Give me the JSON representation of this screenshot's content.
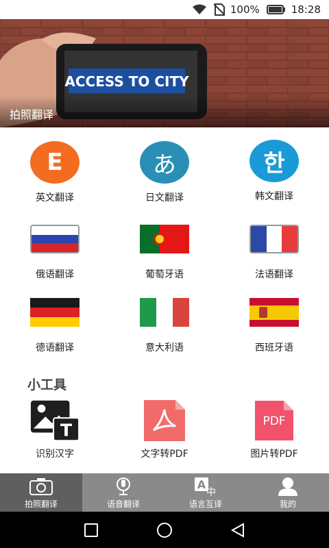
{
  "status_bar": {
    "battery_percent": "100%",
    "time": "18:28"
  },
  "banner": {
    "caption": "拍照翻译",
    "sign_text": "ACCESS TO CITY"
  },
  "languages": [
    {
      "label": "英文翻译",
      "icon": "letter-e-icon",
      "glyph": "E",
      "color": "#f36c21"
    },
    {
      "label": "日文翻译",
      "icon": "hiragana-a-icon",
      "glyph": "あ",
      "color": "#2a8fb5"
    },
    {
      "label": "韩文翻译",
      "icon": "hangul-han-icon",
      "glyph": "한",
      "color": "#1a9ad6"
    },
    {
      "label": "俄语翻译",
      "icon": "russia-flag-icon"
    },
    {
      "label": "葡萄牙语",
      "icon": "portugal-flag-icon"
    },
    {
      "label": "法语翻译",
      "icon": "france-flag-icon"
    },
    {
      "label": "德语翻译",
      "icon": "germany-flag-icon"
    },
    {
      "label": "意大利语",
      "icon": "italy-flag-icon"
    },
    {
      "label": "西班牙语",
      "icon": "spain-flag-icon"
    }
  ],
  "tools": {
    "title": "小工具",
    "items": [
      {
        "label": "识别汉字",
        "icon": "image-text-icon"
      },
      {
        "label": "文字转PDF",
        "icon": "pdf-acrobat-icon",
        "color": "#f26b6b"
      },
      {
        "label": "图片转PDF",
        "icon": "pdf-file-icon",
        "glyph": "PDF",
        "color": "#f2526b"
      }
    ]
  },
  "tabs": [
    {
      "label": "拍照翻译",
      "icon": "camera-icon",
      "active": true
    },
    {
      "label": "语音翻译",
      "icon": "microphone-icon",
      "active": false
    },
    {
      "label": "语言互译",
      "icon": "translate-icon",
      "active": false
    },
    {
      "label": "我的",
      "icon": "person-icon",
      "active": false
    }
  ]
}
